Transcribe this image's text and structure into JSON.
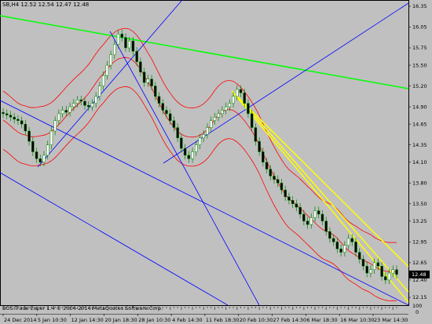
{
  "header": {
    "symbol_line": "SB,H4  12.52 12.54 12.47 12.48"
  },
  "indicator": {
    "label": "BOS Trade Exper 1.4 © 2004-2014 MetaQuotes Software Corp."
  },
  "price_axis": {
    "ticks": [
      "16.35",
      "16.05",
      "15.75",
      "15.50",
      "15.20",
      "14.90",
      "14.65",
      "14.35",
      "14.10",
      "13.80",
      "13.50",
      "13.25",
      "12.95",
      "12.65",
      "12.40",
      "12.15"
    ],
    "current_price": "12.48",
    "indicator_ticks": [
      "100",
      "0"
    ]
  },
  "time_axis": {
    "ticks": [
      "24 Dec 2014",
      "5 Jan 10:30",
      "12 Jan 14:30",
      "20 Jan 18:30",
      "28 Jan 10:30",
      "4 Feb 14:30",
      "11 Feb 18:30",
      "20 Feb 10:30",
      "27 Feb 14:30",
      "6 Mar 18:30",
      "16 Mar 10:30",
      "23 Mar 14:30"
    ]
  },
  "colors": {
    "background": "#c0c0c0",
    "bollinger": "#ff0000",
    "trend_green": "#00ff00",
    "trend_blue": "#0000ff",
    "channel_yellow": "#ffff00",
    "bull_candle": "#ffffff",
    "bear_candle": "#000000",
    "candle_outline": "#008000"
  },
  "chart_data": {
    "type": "candlestick",
    "symbol": "SB",
    "timeframe": "H4",
    "ylim": [
      12.0,
      16.5
    ],
    "closes": [
      14.8,
      14.78,
      14.75,
      14.72,
      14.7,
      14.65,
      14.55,
      14.4,
      14.25,
      14.15,
      14.1,
      14.2,
      14.35,
      14.55,
      14.7,
      14.8,
      14.85,
      14.82,
      14.9,
      14.95,
      15.0,
      14.98,
      14.92,
      14.9,
      14.95,
      15.05,
      15.2,
      15.35,
      15.5,
      15.65,
      15.8,
      15.95,
      15.9,
      15.75,
      15.85,
      15.7,
      15.55,
      15.4,
      15.25,
      15.3,
      15.2,
      15.05,
      14.95,
      14.85,
      14.8,
      14.7,
      14.6,
      14.45,
      14.3,
      14.2,
      14.15,
      14.25,
      14.35,
      14.45,
      14.5,
      14.6,
      14.7,
      14.75,
      14.8,
      14.85,
      14.9,
      14.95,
      15.05,
      15.15,
      15.1,
      14.95,
      14.8,
      14.6,
      14.4,
      14.25,
      14.1,
      14.0,
      13.9,
      13.85,
      13.8,
      13.7,
      13.6,
      13.55,
      13.5,
      13.45,
      13.35,
      13.25,
      13.2,
      13.3,
      13.4,
      13.35,
      13.25,
      13.1,
      13.0,
      12.95,
      12.85,
      12.8,
      12.9,
      13.0,
      12.95,
      12.8,
      12.7,
      12.6,
      12.5,
      12.55,
      12.65,
      12.6,
      12.45,
      12.4,
      12.5,
      12.55,
      12.48
    ]
  }
}
